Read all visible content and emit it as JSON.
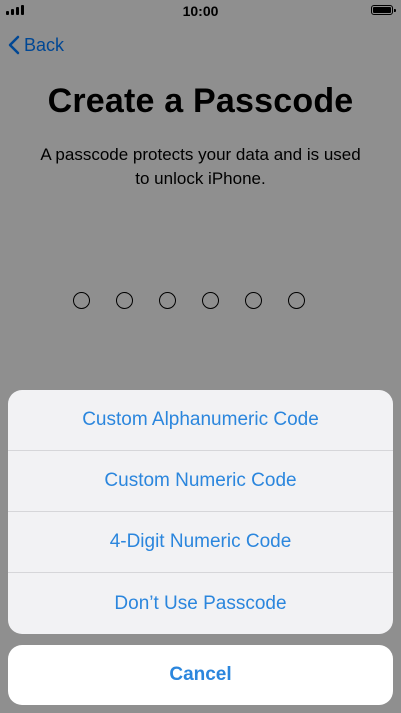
{
  "status_bar": {
    "time": "10:00",
    "signal_icon": "signal-bars-icon",
    "battery_icon": "battery-icon"
  },
  "nav": {
    "back_label": "Back",
    "back_icon": "chevron-left-icon"
  },
  "page": {
    "title": "Create a Passcode",
    "subtitle": "A passcode protects your data and is used to unlock iPhone.",
    "passcode_length": 6
  },
  "action_sheet": {
    "options": [
      {
        "label": "Custom Alphanumeric Code"
      },
      {
        "label": "Custom Numeric Code"
      },
      {
        "label": "4-Digit Numeric Code"
      },
      {
        "label": "Don’t Use Passcode"
      }
    ],
    "cancel_label": "Cancel"
  },
  "colors": {
    "accent": "#2b86dd",
    "sheet_background": "#f2f2f4",
    "dim_overlay": "rgba(0,0,0,0.42)"
  }
}
